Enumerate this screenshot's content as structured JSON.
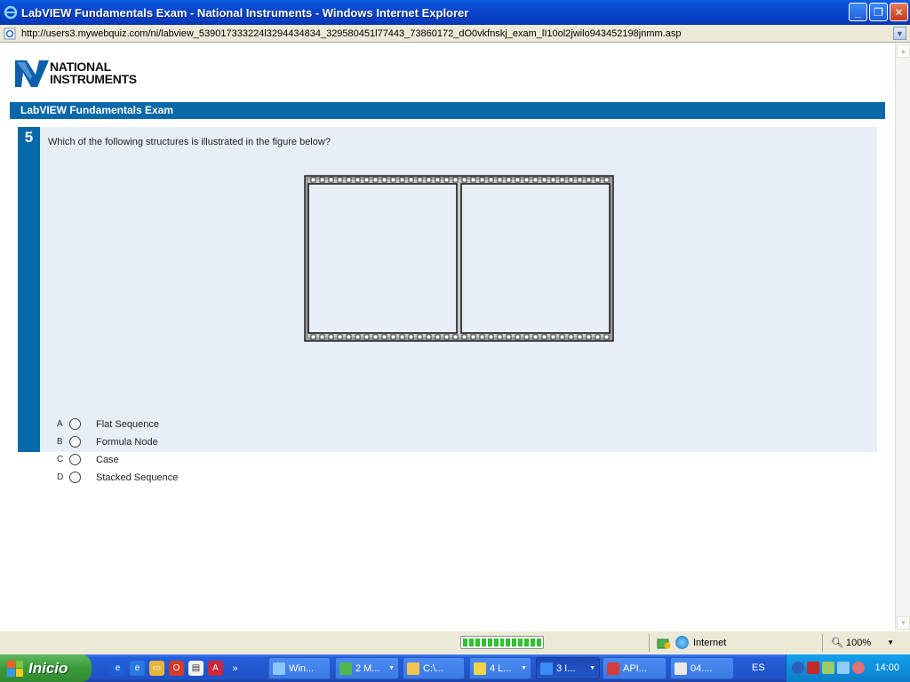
{
  "window": {
    "title": "LabVIEW Fundamentals Exam - National Instruments - Windows Internet Explorer",
    "buttons": {
      "minimize": "_",
      "maximize": "❐",
      "close": "✕"
    }
  },
  "address": {
    "url": "http://users3.mywebquiz.com/ni/labview_539017333224l3294434834_329580451l77443_73860172_dO0vkfnskj_exam_lI10ol2jwilo943452198jnmm.asp"
  },
  "logo": {
    "line1": "NATIONAL",
    "line2": "INSTRUMENTS"
  },
  "exam": {
    "title": "LabVIEW Fundamentals Exam",
    "question_number": "5",
    "question": "Which of the following structures is illustrated in the figure below?",
    "choices": [
      {
        "letter": "A",
        "text": "Flat Sequence"
      },
      {
        "letter": "B",
        "text": "Formula Node"
      },
      {
        "letter": "C",
        "text": "Case"
      },
      {
        "letter": "D",
        "text": "Stacked Sequence"
      }
    ]
  },
  "statusbar": {
    "zone": "Internet",
    "zoom": "100%",
    "progress_fraction": 1.0
  },
  "taskbar": {
    "start_label": "Inicio",
    "tasks": [
      {
        "label": "Win...",
        "active": false
      },
      {
        "label": "2 M...",
        "active": false
      },
      {
        "label": "C:\\...",
        "active": false
      },
      {
        "label": "4 L...",
        "active": false
      },
      {
        "label": "3 I...",
        "active": true
      },
      {
        "label": "API...",
        "active": false
      },
      {
        "label": "04....",
        "active": false
      }
    ],
    "language": "ES",
    "clock": "14:00"
  },
  "colors": {
    "accent": "#0868a8",
    "panel": "#e8eef5",
    "titlebar": "#0a4fd6",
    "taskbar": "#245edb",
    "start": "#3a9a3a"
  }
}
